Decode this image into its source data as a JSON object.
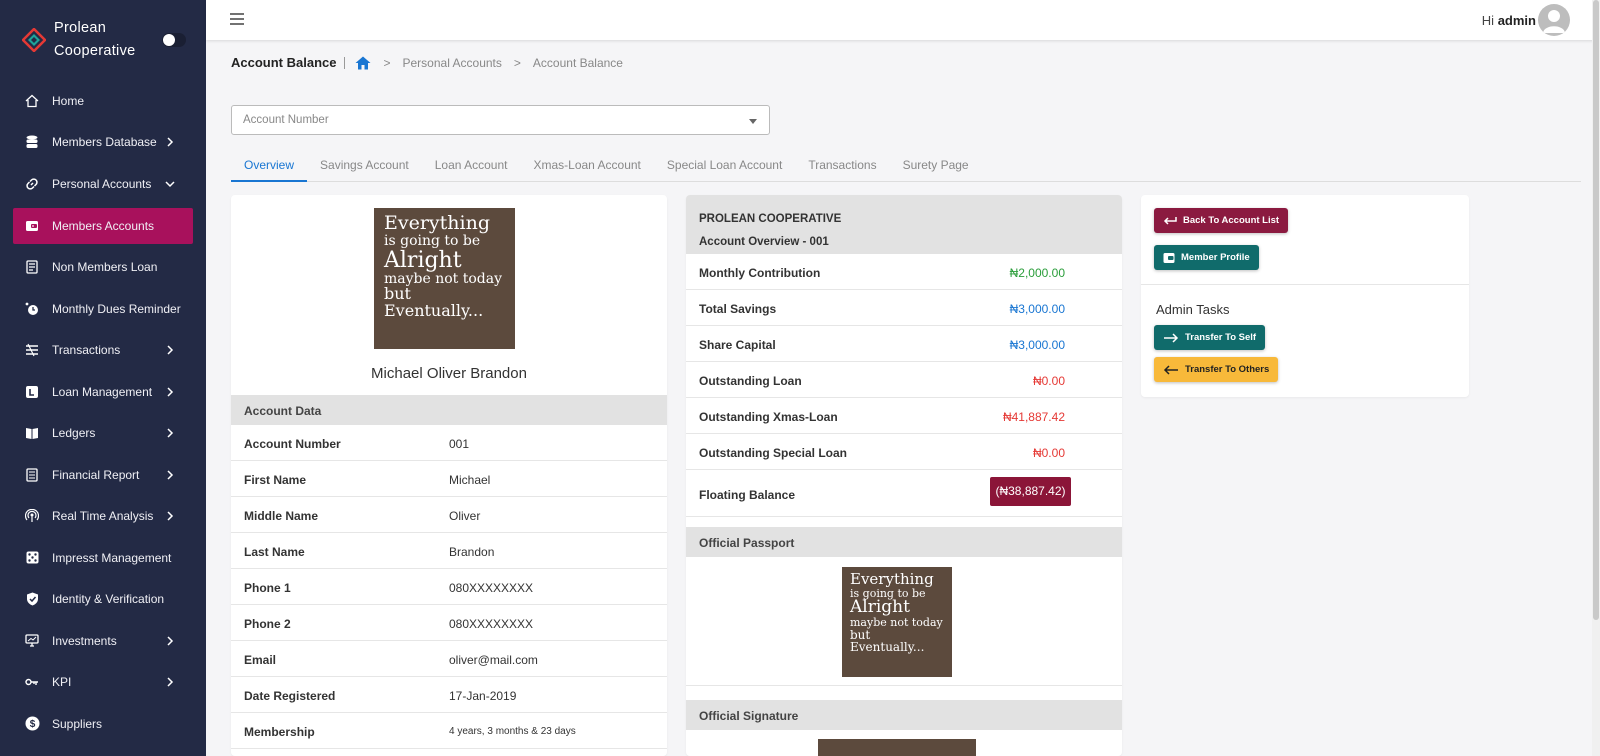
{
  "brand": {
    "line1": "Prolean",
    "line2": "Cooperative"
  },
  "sidebar": {
    "items": [
      {
        "label": "Home",
        "icon": "home-icon"
      },
      {
        "label": "Members Database",
        "icon": "database-icon"
      },
      {
        "label": "Personal Accounts",
        "icon": "link-icon"
      },
      {
        "label": "Members Accounts",
        "icon": "wallet-icon"
      },
      {
        "label": "Non Members Loan",
        "icon": "receipt-icon"
      },
      {
        "label": "Monthly Dues Reminder",
        "icon": "alarm-icon"
      },
      {
        "label": "Transactions",
        "icon": "exchange-icon"
      },
      {
        "label": "Loan Management",
        "icon": "loan-icon"
      },
      {
        "label": "Ledgers",
        "icon": "book-icon"
      },
      {
        "label": "Financial Report",
        "icon": "report-icon"
      },
      {
        "label": "Real Time Analysis",
        "icon": "broadcast-icon"
      },
      {
        "label": "Impresst Management",
        "icon": "dice-icon"
      },
      {
        "label": "Identity & Verification",
        "icon": "shield-check-icon"
      },
      {
        "label": "Investments",
        "icon": "monitor-icon"
      },
      {
        "label": "KPI",
        "icon": "key-icon"
      },
      {
        "label": "Suppliers",
        "icon": "dollar-coin-icon"
      }
    ]
  },
  "header": {
    "greeting": "Hi",
    "user": "admin"
  },
  "breadcrumb": {
    "title": "Account Balance",
    "crumb1": "Personal Accounts",
    "crumb2": "Account Balance"
  },
  "account_select": {
    "placeholder": "Account Number"
  },
  "tabs": [
    "Overview",
    "Savings Account",
    "Loan Account",
    "Xmas-Loan Account",
    "Special Loan Account",
    "Transactions",
    "Surety Page"
  ],
  "poster": {
    "l1": "Everything",
    "l2": "is going to be",
    "l3": "Alright",
    "l4": "maybe not today",
    "l5": "but Eventually..."
  },
  "profile": {
    "name": "Michael Oliver Brandon",
    "section": "Account Data",
    "rows": [
      {
        "k": "Account Number",
        "v": "001"
      },
      {
        "k": "First Name",
        "v": "Michael"
      },
      {
        "k": "Middle Name",
        "v": "Oliver"
      },
      {
        "k": "Last Name",
        "v": "Brandon"
      },
      {
        "k": "Phone 1",
        "v": "080XXXXXXXX"
      },
      {
        "k": "Phone 2",
        "v": "080XXXXXXXX"
      },
      {
        "k": "Email",
        "v": "oliver@mail.com"
      },
      {
        "k": "Date Registered",
        "v": "17-Jan-2019"
      },
      {
        "k": "Membership",
        "v": "4 years, 3 months & 23 days"
      }
    ]
  },
  "overview": {
    "org": "PROLEAN COOPERATIVE",
    "subtitle": "Account Overview - 001",
    "rows": [
      {
        "k": "Monthly Contribution",
        "v": "₦2,000.00",
        "tone": "pos"
      },
      {
        "k": "Total Savings",
        "v": "₦3,000.00",
        "tone": "blue"
      },
      {
        "k": "Share Capital",
        "v": "₦3,000.00",
        "tone": "blue"
      },
      {
        "k": "Outstanding Loan",
        "v": "₦0.00",
        "tone": "neg"
      },
      {
        "k": "Outstanding Xmas-Loan",
        "v": "₦41,887.42",
        "tone": "neg"
      },
      {
        "k": "Outstanding Special Loan",
        "v": "₦0.00",
        "tone": "neg"
      }
    ],
    "floating_label": "Floating Balance",
    "floating_value": "(₦38,887.42)",
    "passport_label": "Official Passport",
    "signature_label": "Official Signature"
  },
  "actions": {
    "back": "Back To Account List",
    "profile": "Member Profile",
    "admin_title": "Admin Tasks",
    "transfer_self": "Transfer To Self",
    "transfer_others": "Transfer To Others"
  },
  "colors": {
    "sidebar": "#232a45",
    "active": "#a8115c",
    "primary": "#1976d2",
    "maroon": "#8b1a40",
    "teal": "#106b6b",
    "amber": "#f8b93a"
  }
}
